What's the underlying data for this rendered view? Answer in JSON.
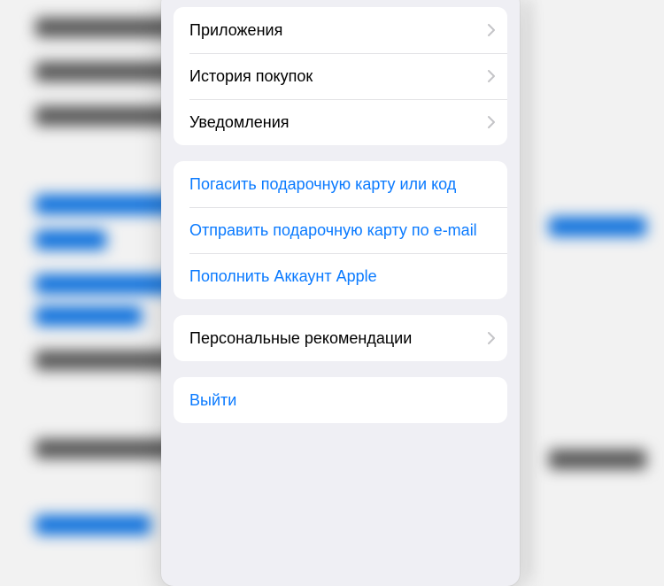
{
  "account_sheet": {
    "group_nav": [
      {
        "label": "Приложения",
        "has_chevron": true
      },
      {
        "label": "История покупок",
        "has_chevron": true
      },
      {
        "label": "Уведомления",
        "has_chevron": true
      }
    ],
    "group_gift": [
      {
        "label": "Погасить подарочную карту или код",
        "style": "link"
      },
      {
        "label": "Отправить подарочную карту по e-mail",
        "style": "link"
      },
      {
        "label": "Пополнить Аккаунт Apple",
        "style": "link"
      }
    ],
    "group_rec": [
      {
        "label": "Персональные рекомендации",
        "has_chevron": true
      }
    ],
    "group_signout": [
      {
        "label": "Выйти",
        "style": "link"
      }
    ]
  },
  "colors": {
    "link": "#0a7aff",
    "sheet_bg": "#efeff4",
    "chevron": "#c4c4c7"
  }
}
